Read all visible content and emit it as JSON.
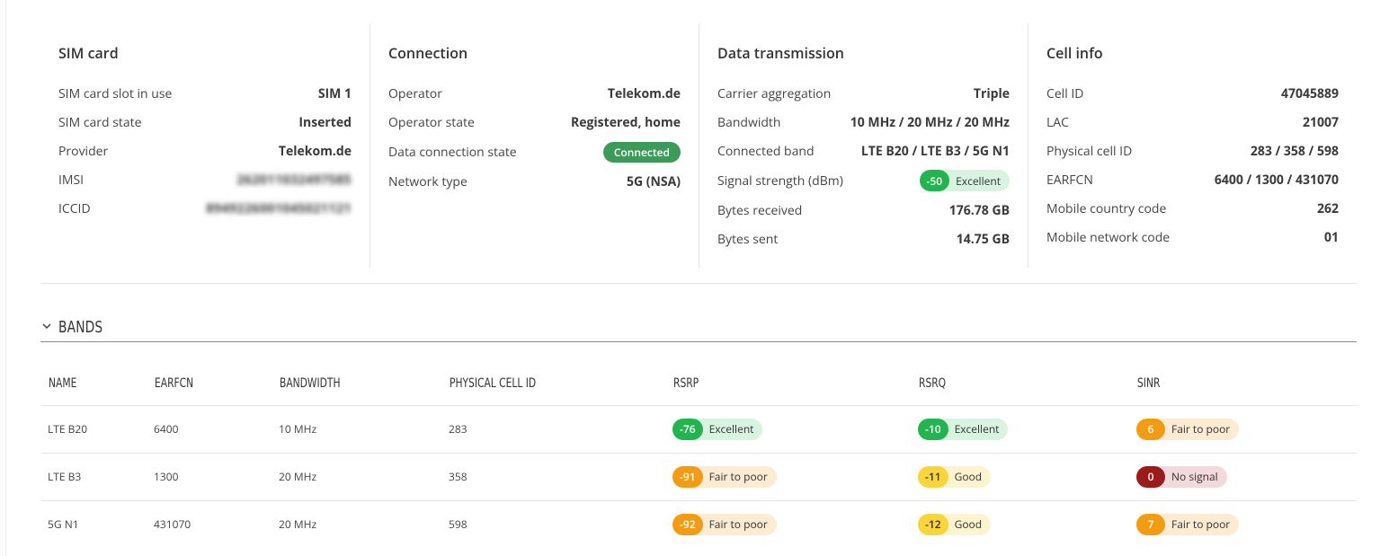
{
  "sim_card": {
    "title": "SIM card",
    "rows": [
      {
        "label": "SIM card slot in use",
        "value": "SIM 1"
      },
      {
        "label": "SIM card state",
        "value": "Inserted"
      },
      {
        "label": "Provider",
        "value": "Telekom.de"
      },
      {
        "label": "IMSI",
        "value": "262011032497585"
      },
      {
        "label": "ICCID",
        "value": "8949226001045021121"
      }
    ]
  },
  "connection": {
    "title": "Connection",
    "rows": [
      {
        "label": "Operator",
        "value": "Telekom.de"
      },
      {
        "label": "Operator state",
        "value": "Registered, home"
      },
      {
        "label": "Data connection state",
        "value": "Connected"
      },
      {
        "label": "Network type",
        "value": "5G (NSA)"
      }
    ]
  },
  "data_transmission": {
    "title": "Data transmission",
    "rows": [
      {
        "label": "Carrier aggregation",
        "value": "Triple"
      },
      {
        "label": "Bandwidth",
        "value": "10 MHz / 20 MHz / 20 MHz"
      },
      {
        "label": "Connected band",
        "value": "LTE B20 / LTE B3 / 5G N1"
      },
      {
        "label": "Signal strength (dBm)",
        "value": "-50",
        "quality": "Excellent"
      },
      {
        "label": "Bytes received",
        "value": "176.78 GB"
      },
      {
        "label": "Bytes sent",
        "value": "14.75 GB"
      }
    ]
  },
  "cell_info": {
    "title": "Cell info",
    "rows": [
      {
        "label": "Cell ID",
        "value": "47045889"
      },
      {
        "label": "LAC",
        "value": "21007"
      },
      {
        "label": "Physical cell ID",
        "value": "283 / 358 / 598"
      },
      {
        "label": "EARFCN",
        "value": "6400 / 1300 / 431070"
      },
      {
        "label": "Mobile country code",
        "value": "262"
      },
      {
        "label": "Mobile network code",
        "value": "01"
      }
    ]
  },
  "bands": {
    "title": "BANDS",
    "columns": [
      "NAME",
      "EARFCN",
      "BANDWIDTH",
      "PHYSICAL CELL ID",
      "RSRP",
      "RSRQ",
      "SINR"
    ],
    "rows": [
      {
        "name": "LTE B20",
        "earfcn": "6400",
        "bandwidth": "10 MHz",
        "pci": "283",
        "rsrp": {
          "value": "-76",
          "quality": "Excellent"
        },
        "rsrq": {
          "value": "-10",
          "quality": "Excellent"
        },
        "sinr": {
          "value": "6",
          "quality": "Fair to poor"
        }
      },
      {
        "name": "LTE B3",
        "earfcn": "1300",
        "bandwidth": "20 MHz",
        "pci": "358",
        "rsrp": {
          "value": "-91",
          "quality": "Fair to poor"
        },
        "rsrq": {
          "value": "-11",
          "quality": "Good"
        },
        "sinr": {
          "value": "0",
          "quality": "No signal"
        }
      },
      {
        "name": "5G N1",
        "earfcn": "431070",
        "bandwidth": "20 MHz",
        "pci": "598",
        "rsrp": {
          "value": "-92",
          "quality": "Fair to poor"
        },
        "rsrq": {
          "value": "-12",
          "quality": "Good"
        },
        "sinr": {
          "value": "7",
          "quality": "Fair to poor"
        }
      }
    ]
  },
  "colors": {
    "excellent": "#22b54f",
    "good": "#f8d53a",
    "fair_to_poor": "#f39c12",
    "no_signal": "#9d1a1a",
    "connected": "#3d9b5a"
  }
}
